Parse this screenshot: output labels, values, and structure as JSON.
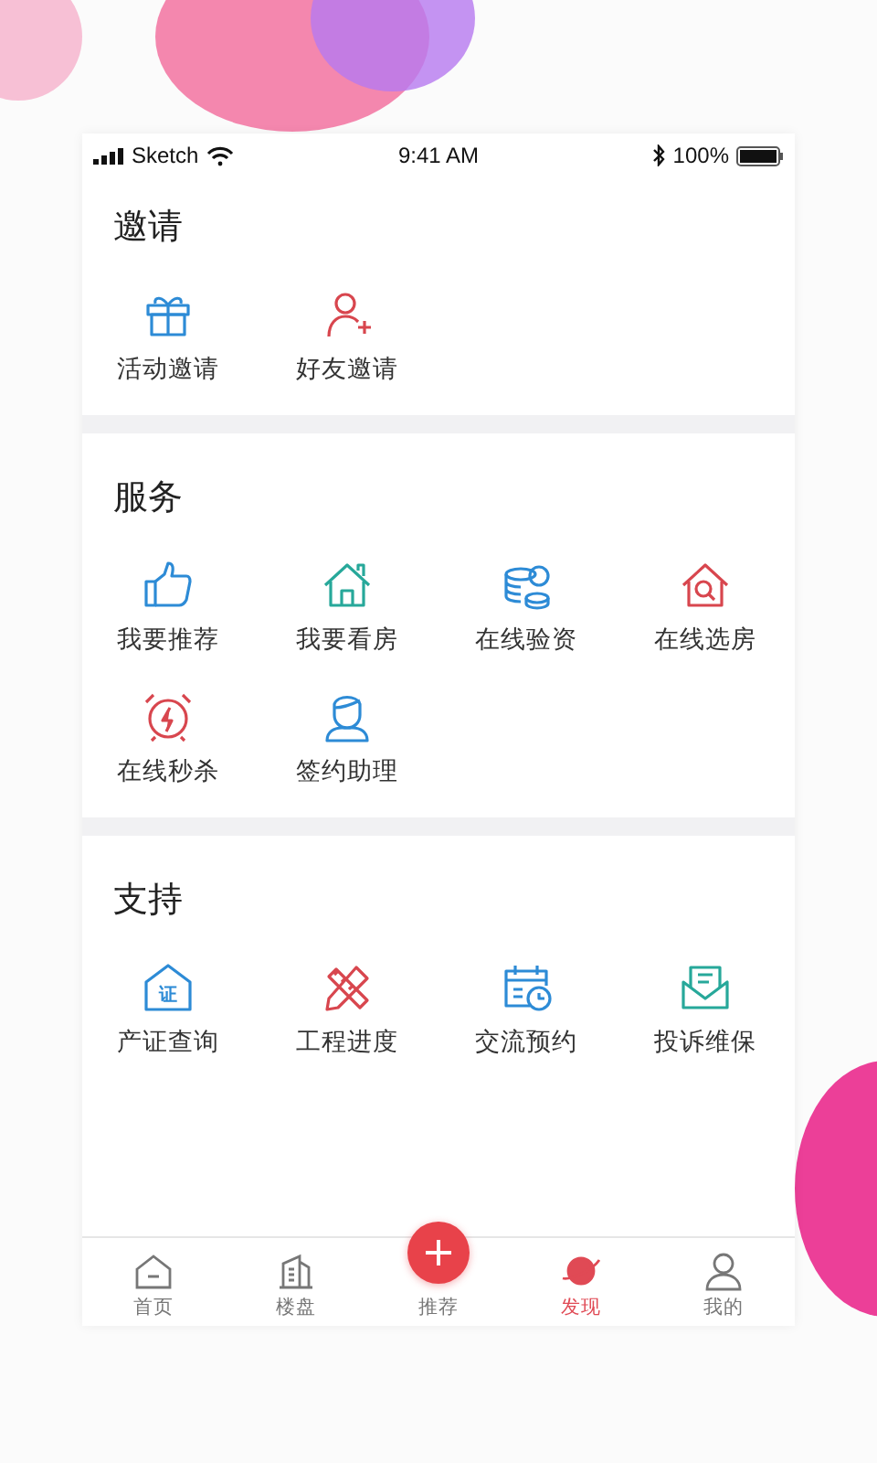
{
  "status_bar": {
    "carrier": "Sketch",
    "time": "9:41 AM",
    "battery": "100%"
  },
  "sections": [
    {
      "title": "邀请",
      "items": [
        {
          "kind": "gift",
          "label": "活动邀请"
        },
        {
          "kind": "add-user",
          "label": "好友邀请"
        }
      ]
    },
    {
      "title": "服务",
      "items": [
        {
          "kind": "thumb",
          "label": "我要推荐"
        },
        {
          "kind": "house",
          "label": "我要看房"
        },
        {
          "kind": "coins",
          "label": "在线验资"
        },
        {
          "kind": "house-search",
          "label": "在线选房"
        },
        {
          "kind": "alarm",
          "label": "在线秒杀"
        },
        {
          "kind": "agent",
          "label": "签约助理"
        }
      ]
    },
    {
      "title": "支持",
      "items": [
        {
          "kind": "cert",
          "label": "产证查询",
          "badge": "证"
        },
        {
          "kind": "tools",
          "label": "工程进度"
        },
        {
          "kind": "calendar",
          "label": "交流预约"
        },
        {
          "kind": "mail",
          "label": "投诉维保"
        }
      ]
    }
  ],
  "tab_bar": [
    {
      "kind": "home",
      "label": "首页",
      "selected": false
    },
    {
      "kind": "building",
      "label": "楼盘",
      "selected": false
    },
    {
      "kind": "plus",
      "label": "推荐",
      "selected": false
    },
    {
      "kind": "planet",
      "label": "发现",
      "selected": true
    },
    {
      "kind": "user",
      "label": "我的",
      "selected": false
    }
  ]
}
